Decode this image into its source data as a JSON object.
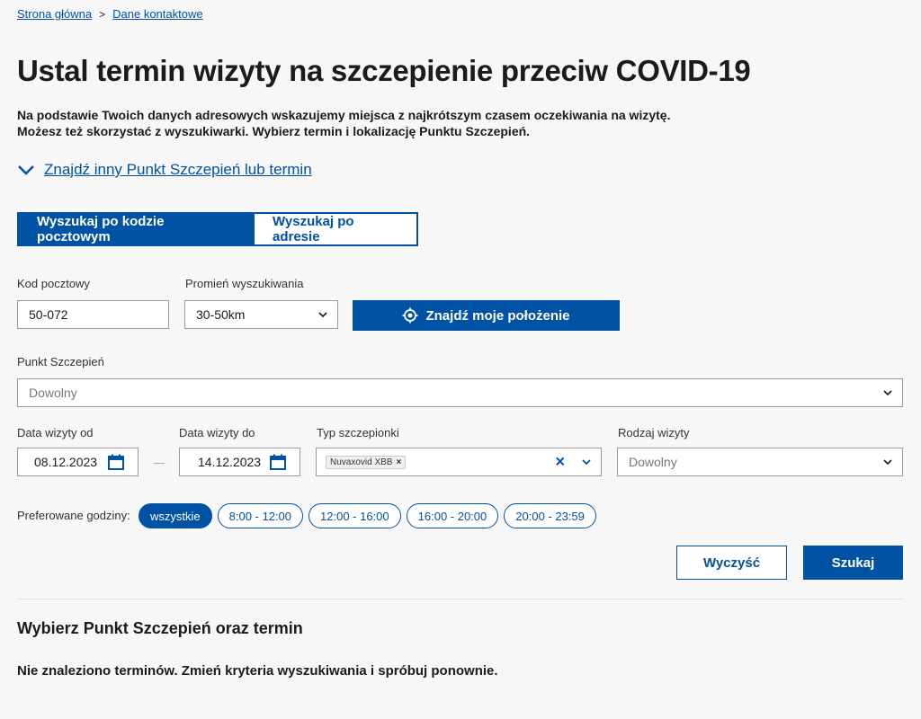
{
  "breadcrumb": {
    "home": "Strona główna",
    "separator": ">",
    "current": "Dane kontaktowe"
  },
  "page": {
    "title": "Ustal termin wizyty na szczepienie przeciw COVID-19",
    "intro_line1": "Na podstawie Twoich danych adresowych wskazujemy miejsca z najkrótszym czasem oczekiwania na wizytę.",
    "intro_line2": "Możesz też skorzystać z wyszukiwarki. Wybierz termin i lokalizację Punktu Szczepień.",
    "toggle_label": "Znajdź inny Punkt Szczepień lub termin"
  },
  "tabs": {
    "postal": "Wyszukaj po kodzie pocztowym",
    "address": "Wyszukaj po adresie"
  },
  "form": {
    "postal_label": "Kod pocztowy",
    "postal_value": "50-072",
    "radius_label": "Promień wyszukiwania",
    "radius_value": "30-50km",
    "locate_button": "Znajdź moje położenie",
    "point_label": "Punkt Szczepień",
    "point_value": "Dowolny",
    "date_from_label": "Data wizyty od",
    "date_from_value": "08.12.2023",
    "date_to_label": "Data wizyty do",
    "date_to_value": "14.12.2023",
    "vaccine_label": "Typ szczepionki",
    "vaccine_tag": "Nuvaxovid XBB",
    "vaccine_clear": "×",
    "visit_type_label": "Rodzaj wizyty",
    "visit_type_value": "Dowolny"
  },
  "hours": {
    "label": "Preferowane godziny:",
    "options": [
      "wszystkie",
      "8:00 - 12:00",
      "12:00 - 16:00",
      "16:00 - 20:00",
      "20:00 - 23:59"
    ]
  },
  "actions": {
    "clear": "Wyczyść",
    "search": "Szukaj"
  },
  "results": {
    "title": "Wybierz Punkt Szczepień oraz termin",
    "empty": "Nie znaleziono terminów. Zmień kryteria wyszukiwania i spróbuj ponownie."
  },
  "colors": {
    "primary": "#0052a5",
    "background": "#f7f7f7"
  }
}
